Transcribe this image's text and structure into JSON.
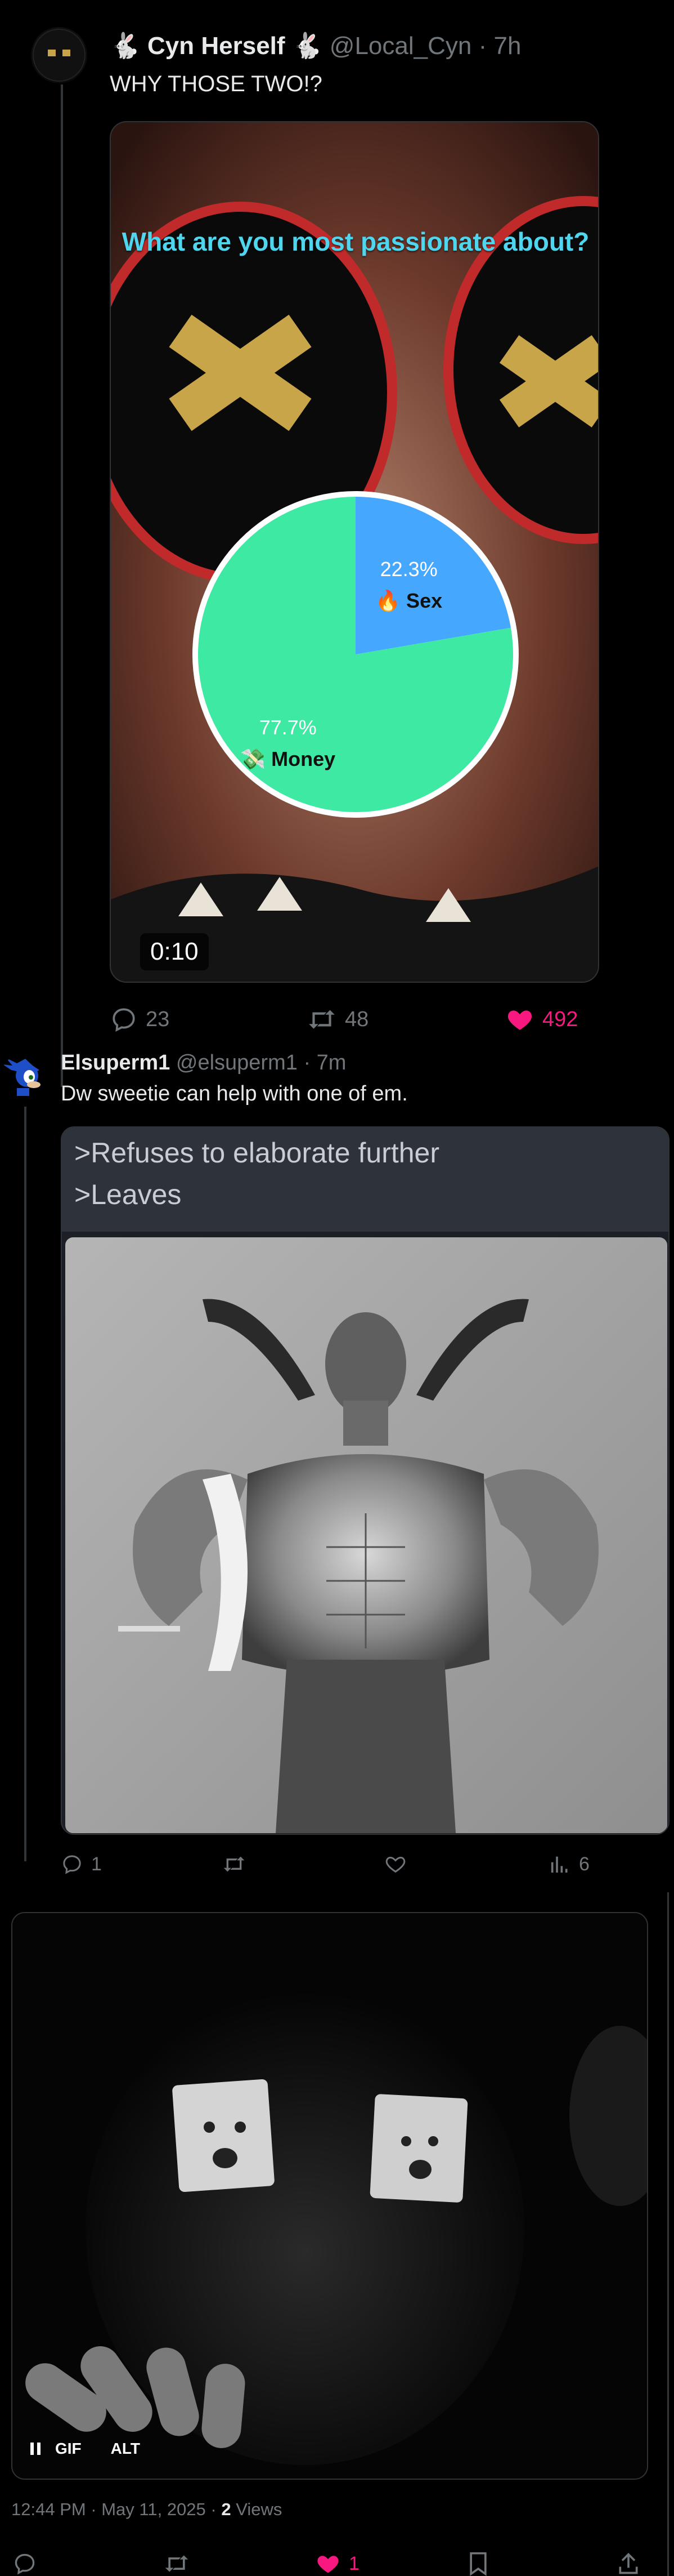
{
  "post1": {
    "display_name": "🐇 Cyn Herself 🐇",
    "handle": "@Local_Cyn",
    "time": "· 7h",
    "text": "WHY THOSE TWO!?",
    "video": {
      "overlay_title": "What are you most passionate about?",
      "duration": "0:10"
    },
    "actions": {
      "replies": "23",
      "reposts": "48",
      "likes": "492"
    }
  },
  "chart_data": {
    "type": "pie",
    "title": "What are you most passionate about?",
    "categories": [
      "Sex",
      "Money"
    ],
    "values": [
      22.3,
      77.7
    ],
    "labels": [
      "22.3%",
      "77.7%"
    ],
    "icons": [
      "🔥",
      "💸"
    ],
    "colors": [
      "#46a7ff",
      "#3ee9a3"
    ]
  },
  "post2": {
    "display_name": "Elsuperm1",
    "handle": "@elsuperm1",
    "time": "· 7m",
    "text": "Dw sweetie can help with one of em.",
    "image": {
      "caption_line1": ">Refuses to elaborate further",
      "caption_line2": ">Leaves"
    },
    "actions": {
      "replies": "1",
      "views": "6"
    }
  },
  "post3": {
    "gif_badge": "GIF",
    "alt_badge": "ALT",
    "timestamp": "12:44 PM · May 11, 2025 ·",
    "views_count": "2",
    "views_label": "Views",
    "actions": {
      "likes": "1"
    }
  },
  "colors": {
    "like_active": "#f91880",
    "muted": "#71767b",
    "text": "#e7e9ea"
  }
}
